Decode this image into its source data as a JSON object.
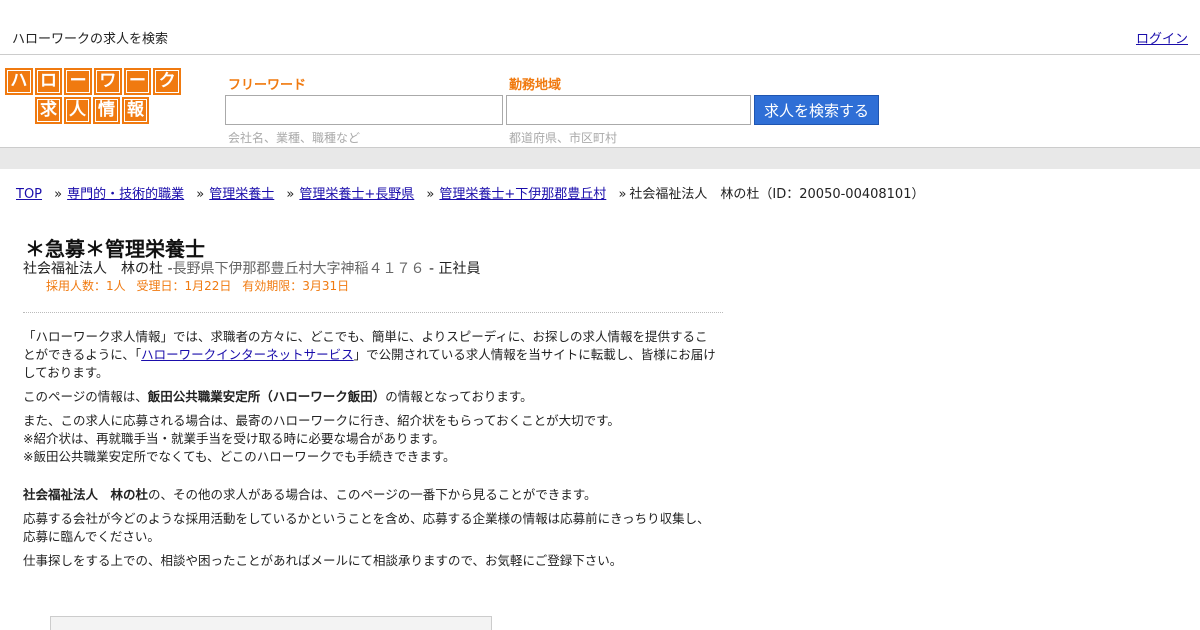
{
  "topbar": {
    "tagline": "ハローワークの求人を検索",
    "login": "ログイン"
  },
  "logo": {
    "row1": [
      "ハ",
      "ロ",
      "ー",
      "ワ",
      "ー",
      "ク"
    ],
    "row2": [
      "求",
      "人",
      "情",
      "報"
    ]
  },
  "search": {
    "freeword_label": "フリーワード",
    "freeword_hint": "会社名、業種、職種など",
    "area_label": "勤務地域",
    "area_hint": "都道府県、市区町村",
    "button": "求人を検索する"
  },
  "breadcrumb": {
    "items": [
      "TOP",
      "専門的・技術的職業",
      "管理栄養士",
      "管理栄養士+長野県",
      "管理栄養士+下伊那郡豊丘村"
    ],
    "current": "社会福祉法人　林の杜（ID：20050-00408101）"
  },
  "job": {
    "title": "＊急募＊管理栄養士",
    "company": "社会福祉法人　林の杜",
    "address": "長野県下伊那郡豊丘村大字神稲４１７６",
    "employment": "正社員",
    "meta": [
      "採用人数：1人",
      "受理日：1月22日",
      "有効期限：3月31日"
    ]
  },
  "intro": {
    "p1_a": "「ハローワーク求人情報」では、求職者の方々に、どこでも、簡単に、よりスピーディに、お探しの求人情報を提供することができるように、「",
    "p1_link": "ハローワークインターネットサービス",
    "p1_b": "」で公開されている求人情報を当サイトに転載し、皆様にお届けしております。",
    "p2_a": "このページの情報は、",
    "p2_bold": "飯田公共職業安定所（ハローワーク飯田）",
    "p2_b": "の情報となっております。",
    "p3_l1": "また、この求人に応募される場合は、最寄のハローワークに行き、紹介状をもらっておくことが大切です。",
    "p3_l2": "※紹介状は、再就職手当・就業手当を受け取る時に必要な場合があります。",
    "p3_l3": "※飯田公共職業安定所でなくても、どこのハローワークでも手続きできます。",
    "p4_bold": "社会福祉法人　林の杜",
    "p4_b": "の、その他の求人がある場合は、このページの一番下から見ることができます。",
    "p5": "応募する会社が今どのような採用活動をしているかということを含め、応募する企業様の情報は応募前にきっちり収集し、応募に臨んでください。",
    "p6": "仕事探しをする上での、相談や困ったことがあればメールにて相談承りますので、お気軽にご登録下さい。"
  }
}
